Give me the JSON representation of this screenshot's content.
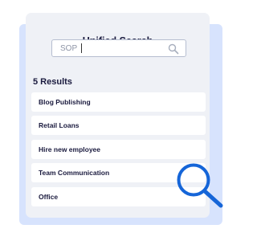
{
  "search_panel": {
    "title": "Unified Search",
    "search": {
      "value": "SOP",
      "placeholder": "",
      "icon": "search-icon"
    },
    "results_heading": "5 Results",
    "results": [
      {
        "label": "Blog Publishing"
      },
      {
        "label": "Retail Loans"
      },
      {
        "label": "Hire new employee"
      },
      {
        "label": "Team Communication"
      },
      {
        "label": "Office"
      }
    ]
  },
  "decoration": {
    "icon": "magnifying-glass-icon"
  },
  "colors": {
    "accent_blue": "#1565d8",
    "panel_background": "#eff1f6",
    "backdrop": "#d7e3fd",
    "text_dark": "#1a1a3e"
  }
}
